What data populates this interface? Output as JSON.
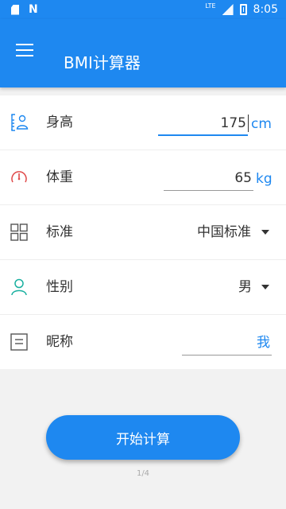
{
  "status_bar": {
    "lte": "LTE",
    "time": "8:05"
  },
  "app_bar": {
    "title": "BMI计算器"
  },
  "form": {
    "height": {
      "label": "身高",
      "value": "175",
      "unit": "cm"
    },
    "weight": {
      "label": "体重",
      "value": "65",
      "unit": "kg"
    },
    "standard": {
      "label": "标准",
      "selected": "中国标准"
    },
    "gender": {
      "label": "性别",
      "selected": "男"
    },
    "nickname": {
      "label": "昵称",
      "value": "我"
    }
  },
  "actions": {
    "start_label": "开始计算"
  },
  "pager": {
    "text": "1/4"
  },
  "colors": {
    "accent": "#1e88f0",
    "icon_red": "#e04b4b",
    "icon_teal": "#1ab0a0"
  },
  "icons": [
    "sd-card-icon",
    "n-notification-icon",
    "signal-icon",
    "battery-icon",
    "menu-icon",
    "height-icon",
    "weight-gauge-icon",
    "grid-icon",
    "person-icon",
    "note-icon"
  ]
}
